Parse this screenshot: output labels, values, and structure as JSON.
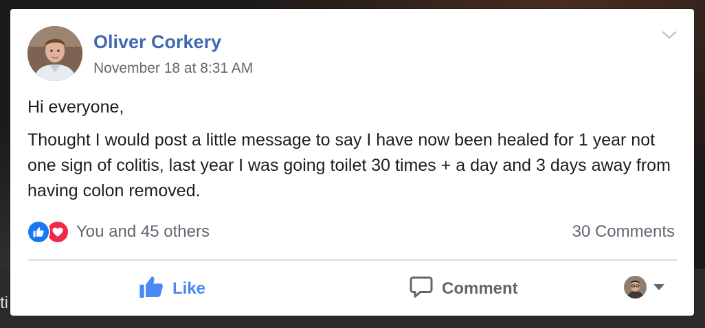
{
  "post": {
    "author": "Oliver Corkery",
    "timestamp": "November 18 at 8:31 AM",
    "paragraphs": [
      "Hi everyone,",
      "Thought I would post a little message to say I have now been healed for 1 year not one sign of colitis, last year I was going toilet 30 times + a day and 3 days away from having colon removed."
    ],
    "options_icon": "chevron-down-icon"
  },
  "engagement": {
    "reactions": [
      "like",
      "love"
    ],
    "reactions_text": "You and 45 others",
    "comments_text": "30 Comments"
  },
  "actions": {
    "like_label": "Like",
    "comment_label": "Comment"
  },
  "background": {
    "edge_text": "ti"
  },
  "colors": {
    "author_link": "#4267b2",
    "like_action": "#4b87f5",
    "like_reaction": "#1877f2",
    "love_reaction": "#f0284a",
    "secondary_text": "#616770"
  }
}
